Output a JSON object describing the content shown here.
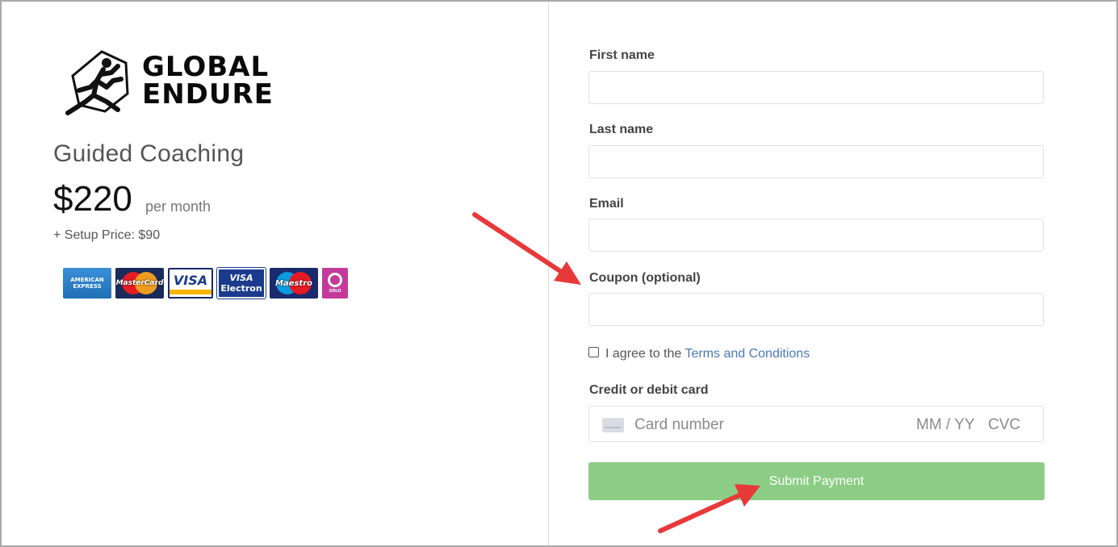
{
  "brand": {
    "line1": "GLOBAL",
    "line2": "ENDURE"
  },
  "product": {
    "title": "Guided Coaching",
    "price": "$220",
    "period": "per month",
    "setup": "+ Setup Price: $90"
  },
  "accepted_cards": [
    {
      "name": "American Express",
      "text": "AMERICAN EXPRESS"
    },
    {
      "name": "MasterCard",
      "text": "MasterCard"
    },
    {
      "name": "Visa",
      "text": "VISA"
    },
    {
      "name": "Visa Electron",
      "text1": "VISA",
      "text2": "Electron"
    },
    {
      "name": "Maestro",
      "text": "Maestro"
    },
    {
      "name": "Solo",
      "text": "SOLO"
    }
  ],
  "form": {
    "first_name_label": "First name",
    "last_name_label": "Last name",
    "email_label": "Email",
    "coupon_label": "Coupon (optional)",
    "agree_prefix": "I agree to the",
    "terms_link": "Terms and Conditions",
    "agree_checked": false,
    "card_label": "Credit or debit card",
    "card_number_placeholder": "Card number",
    "card_expiry_placeholder": "MM / YY",
    "card_cvc_placeholder": "CVC",
    "submit_label": "Submit Payment"
  },
  "colors": {
    "submit_button": "#8bcd84",
    "link": "#4a7ab8",
    "annotation_arrow": "#e8393a"
  }
}
